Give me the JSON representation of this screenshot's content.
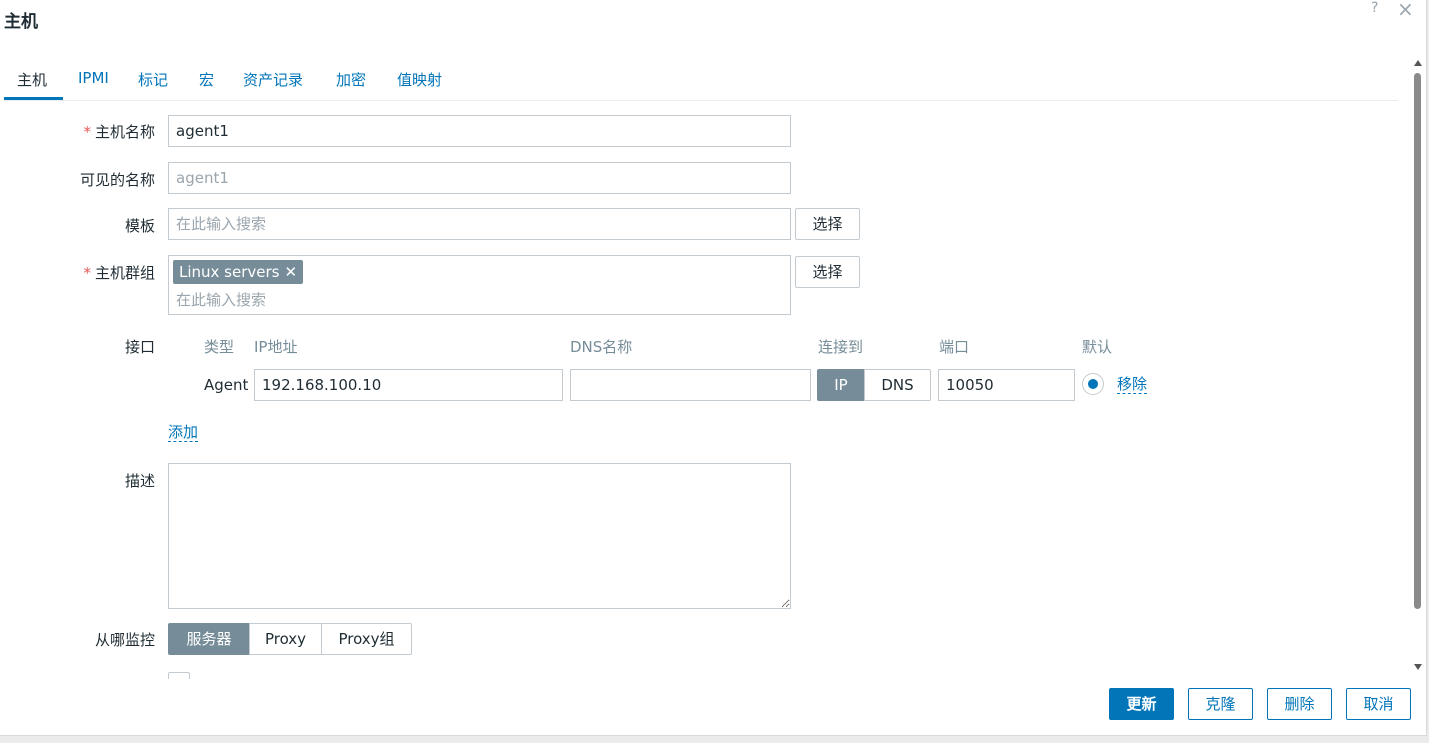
{
  "dialog": {
    "title": "主机",
    "help_icon": "?",
    "close_icon": "×"
  },
  "tabs": [
    {
      "label": "主机",
      "active": true
    },
    {
      "label": "IPMI"
    },
    {
      "label": "标记"
    },
    {
      "label": "宏"
    },
    {
      "label": "资产记录"
    },
    {
      "label": "加密"
    },
    {
      "label": "值映射"
    }
  ],
  "form": {
    "required_mark": "*",
    "host_name": {
      "label": "主机名称",
      "value": "agent1"
    },
    "visible_name": {
      "label": "可见的名称",
      "placeholder": "agent1"
    },
    "templates": {
      "label": "模板",
      "placeholder": "在此输入搜索",
      "select_label": "选择"
    },
    "host_groups": {
      "label": "主机群组",
      "chip": "Linux servers",
      "chip_remove": "✕",
      "placeholder": "在此输入搜索",
      "select_label": "选择"
    },
    "interfaces": {
      "label": "接口",
      "headers": {
        "type": "类型",
        "ip": "IP地址",
        "dns": "DNS名称",
        "connect": "连接到",
        "port": "端口",
        "default": "默认"
      },
      "row": {
        "type": "Agent",
        "ip": "192.168.100.10",
        "dns": "",
        "connect_ip": "IP",
        "connect_dns": "DNS",
        "connect_selected": "IP",
        "port": "10050",
        "default": true,
        "remove": "移除"
      },
      "add_link": "添加"
    },
    "description": {
      "label": "描述",
      "value": ""
    },
    "monitored_by": {
      "label": "从哪监控",
      "options": [
        "服务器",
        "Proxy",
        "Proxy组"
      ],
      "selected": "服务器"
    }
  },
  "footer": {
    "update": "更新",
    "clone": "克隆",
    "delete": "删除",
    "cancel": "取消"
  },
  "colors": {
    "accent": "#0275b8",
    "segment_selected": "#768d99",
    "required": "#e45959"
  }
}
